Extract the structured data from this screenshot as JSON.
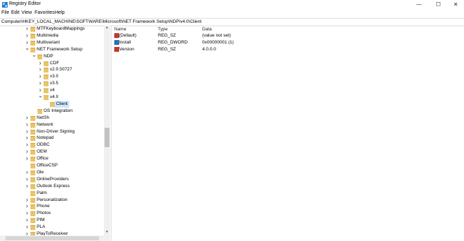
{
  "window": {
    "title": "Registry Editor",
    "controls": [
      "—",
      "☐",
      "✕"
    ]
  },
  "menu": [
    "File",
    "Edit",
    "View",
    "Favorites",
    "Help"
  ],
  "address": "Computer\\HKEY_LOCAL_MACHINE\\SOFTWARE\\Microsoft\\NET Framework Setup\\NDP\\v4.0\\Client",
  "tree": [
    {
      "label": "MTFKeyboardMappings",
      "depth": 0,
      "expander": "right"
    },
    {
      "label": "Multimedia",
      "depth": 0,
      "expander": "right"
    },
    {
      "label": "Multivariant",
      "depth": 0,
      "expander": "right"
    },
    {
      "label": "NET Framework Setup",
      "depth": 0,
      "expander": "down"
    },
    {
      "label": "NDP",
      "depth": 1,
      "expander": "down"
    },
    {
      "label": "CDF",
      "depth": 2,
      "expander": "right"
    },
    {
      "label": "v2.0.50727",
      "depth": 2,
      "expander": "right"
    },
    {
      "label": "v3.0",
      "depth": 2,
      "expander": "right"
    },
    {
      "label": "v3.5",
      "depth": 2,
      "expander": "right"
    },
    {
      "label": "v4",
      "depth": 2,
      "expander": "right"
    },
    {
      "label": "v4.0",
      "depth": 2,
      "expander": "down"
    },
    {
      "label": "Client",
      "depth": 3,
      "expander": "none",
      "selected": true
    },
    {
      "label": "OS Integration",
      "depth": 1,
      "expander": "none"
    },
    {
      "label": "NetSh",
      "depth": 0,
      "expander": "right"
    },
    {
      "label": "Network",
      "depth": 0,
      "expander": "right"
    },
    {
      "label": "Non-Driver Signing",
      "depth": 0,
      "expander": "right"
    },
    {
      "label": "Notepad",
      "depth": 0,
      "expander": "right"
    },
    {
      "label": "ODBC",
      "depth": 0,
      "expander": "right"
    },
    {
      "label": "OEM",
      "depth": 0,
      "expander": "right"
    },
    {
      "label": "Office",
      "depth": 0,
      "expander": "right"
    },
    {
      "label": "OfficeCSP",
      "depth": 0,
      "expander": "none"
    },
    {
      "label": "Ole",
      "depth": 0,
      "expander": "right"
    },
    {
      "label": "OnlineProviders",
      "depth": 0,
      "expander": "right"
    },
    {
      "label": "Outlook Express",
      "depth": 0,
      "expander": "right"
    },
    {
      "label": "Palm",
      "depth": 0,
      "expander": "none"
    },
    {
      "label": "Personalization",
      "depth": 0,
      "expander": "right"
    },
    {
      "label": "Phone",
      "depth": 0,
      "expander": "right"
    },
    {
      "label": "Photos",
      "depth": 0,
      "expander": "right"
    },
    {
      "label": "PIM",
      "depth": 0,
      "expander": "right"
    },
    {
      "label": "PLA",
      "depth": 0,
      "expander": "right"
    },
    {
      "label": "PlayToReceiver",
      "depth": 0,
      "expander": "right"
    }
  ],
  "columns": {
    "name": "Name",
    "type": "Type",
    "data": "Data"
  },
  "values": [
    {
      "name": "(Default)",
      "type": "REG_SZ",
      "data": "(value not set)",
      "icon": "string-value-icon"
    },
    {
      "name": "Install",
      "type": "REG_DWORD",
      "data": "0x00000001 (1)",
      "icon": "dword-value-icon"
    },
    {
      "name": "Version",
      "type": "REG_SZ",
      "data": "4.0.0.0",
      "icon": "string-value-icon"
    }
  ],
  "colors": {
    "selection": "#cce8ff",
    "folder": "#e9c46a",
    "string_icon": "#c0392b",
    "dword_icon": "#2e6fb8"
  }
}
